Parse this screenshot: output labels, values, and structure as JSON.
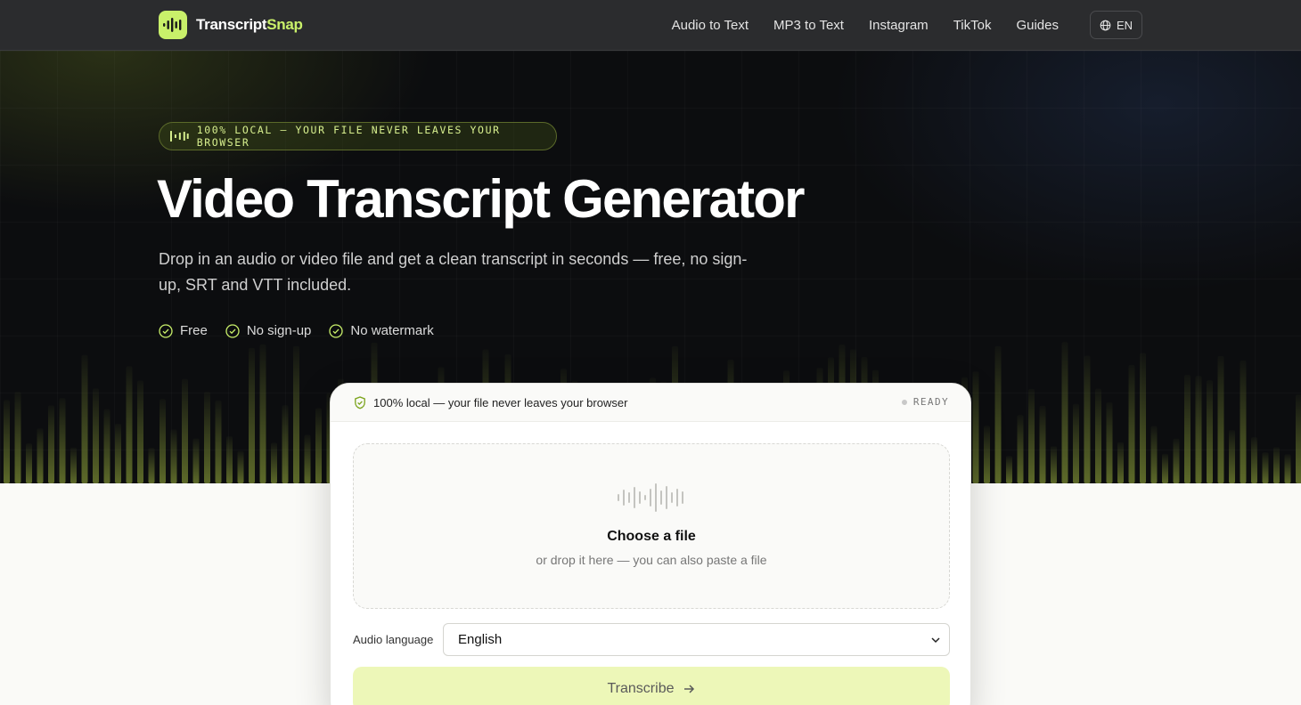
{
  "brand": {
    "name_part1": "Transcript",
    "name_part2": "Snap",
    "accent": "#c9f06a"
  },
  "nav": {
    "links": [
      "Audio to Text",
      "MP3 to Text",
      "Instagram",
      "TikTok",
      "Guides"
    ],
    "language": "EN"
  },
  "hero": {
    "badge": "100% LOCAL — YOUR FILE NEVER LEAVES YOUR BROWSER",
    "title": "Video Transcript Generator",
    "subtitle": "Drop in an audio or video file and get a clean transcript in seconds — free, no sign-up, SRT and VTT included.",
    "checks": [
      "Free",
      "No sign-up",
      "No watermark"
    ]
  },
  "card": {
    "local_note": "100% local — your file never leaves your browser",
    "status": "READY",
    "dropzone": {
      "title": "Choose a file",
      "subtitle": "or drop it here — you can also paste a file"
    },
    "language": {
      "label": "Audio language",
      "selected": "English"
    },
    "transcribe_label": "Transcribe"
  },
  "colors": {
    "hero_bg": "#0c0d0f",
    "nav_bg": "#2b2c2e",
    "bar_color": "#6b7a2e",
    "button_bg": "#edf7b8"
  }
}
